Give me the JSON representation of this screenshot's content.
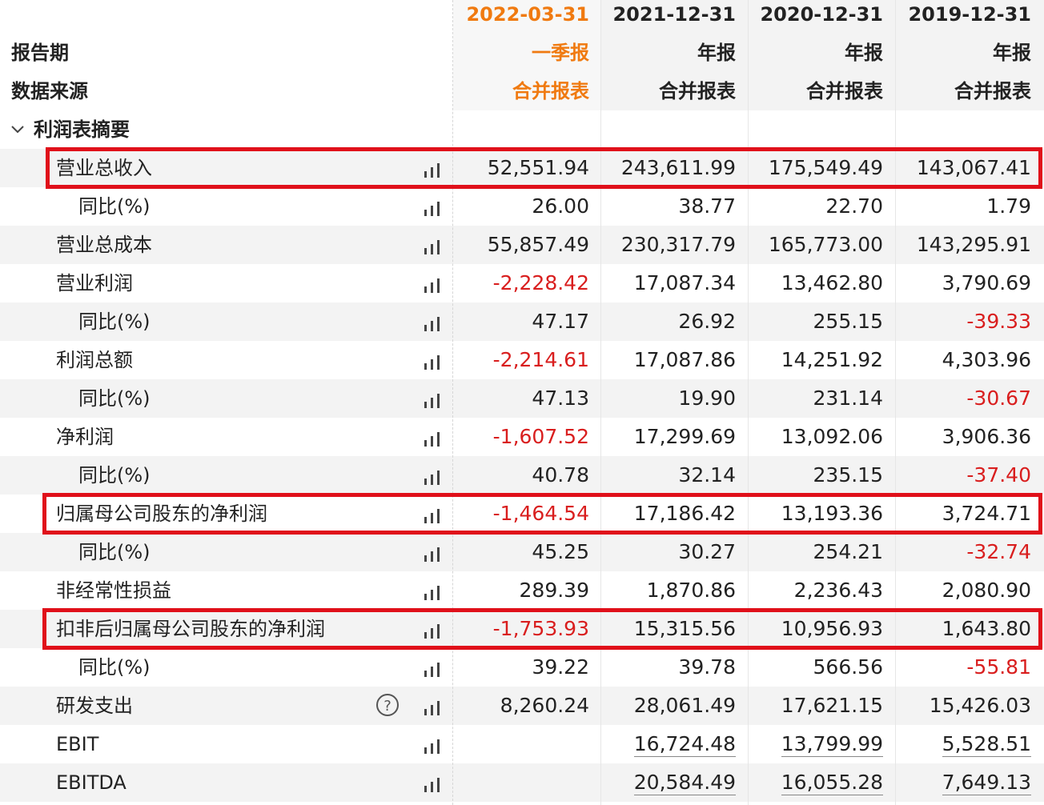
{
  "header": {
    "periods": [
      "2022-03-31",
      "2021-12-31",
      "2020-12-31",
      "2019-12-31"
    ],
    "report_period_label": "报告期",
    "report_types": [
      "一季报",
      "年报",
      "年报",
      "年报"
    ],
    "source_label": "数据来源",
    "sources": [
      "合并报表",
      "合并报表",
      "合并报表",
      "合并报表"
    ]
  },
  "section": {
    "title": "利润表摘要",
    "expand_icon": "chevron-down-icon"
  },
  "rows": [
    {
      "name": "营业总收入",
      "level": 1,
      "values": [
        "52,551.94",
        "243,611.99",
        "175,549.49",
        "143,067.41"
      ],
      "neg": [
        false,
        false,
        false,
        false
      ],
      "highlight": true
    },
    {
      "name": "同比(%)",
      "level": 2,
      "values": [
        "26.00",
        "38.77",
        "22.70",
        "1.79"
      ],
      "neg": [
        false,
        false,
        false,
        false
      ]
    },
    {
      "name": "营业总成本",
      "level": 1,
      "values": [
        "55,857.49",
        "230,317.79",
        "165,773.00",
        "143,295.91"
      ],
      "neg": [
        false,
        false,
        false,
        false
      ]
    },
    {
      "name": "营业利润",
      "level": 1,
      "values": [
        "-2,228.42",
        "17,087.34",
        "13,462.80",
        "3,790.69"
      ],
      "neg": [
        true,
        false,
        false,
        false
      ]
    },
    {
      "name": "同比(%)",
      "level": 2,
      "values": [
        "47.17",
        "26.92",
        "255.15",
        "-39.33"
      ],
      "neg": [
        false,
        false,
        false,
        true
      ]
    },
    {
      "name": "利润总额",
      "level": 1,
      "values": [
        "-2,214.61",
        "17,087.86",
        "14,251.92",
        "4,303.96"
      ],
      "neg": [
        true,
        false,
        false,
        false
      ]
    },
    {
      "name": "同比(%)",
      "level": 2,
      "values": [
        "47.13",
        "19.90",
        "231.14",
        "-30.67"
      ],
      "neg": [
        false,
        false,
        false,
        true
      ]
    },
    {
      "name": "净利润",
      "level": 1,
      "values": [
        "-1,607.52",
        "17,299.69",
        "13,092.06",
        "3,906.36"
      ],
      "neg": [
        true,
        false,
        false,
        false
      ]
    },
    {
      "name": "同比(%)",
      "level": 2,
      "values": [
        "40.78",
        "32.14",
        "235.15",
        "-37.40"
      ],
      "neg": [
        false,
        false,
        false,
        true
      ]
    },
    {
      "name": "归属母公司股东的净利润",
      "level": 1,
      "values": [
        "-1,464.54",
        "17,186.42",
        "13,193.36",
        "3,724.71"
      ],
      "neg": [
        true,
        false,
        false,
        false
      ],
      "highlight": true
    },
    {
      "name": "同比(%)",
      "level": 2,
      "values": [
        "45.25",
        "30.27",
        "254.21",
        "-32.74"
      ],
      "neg": [
        false,
        false,
        false,
        true
      ]
    },
    {
      "name": "非经常性损益",
      "level": 1,
      "values": [
        "289.39",
        "1,870.86",
        "2,236.43",
        "2,080.90"
      ],
      "neg": [
        false,
        false,
        false,
        false
      ]
    },
    {
      "name": "扣非后归属母公司股东的净利润",
      "level": 1,
      "values": [
        "-1,753.93",
        "15,315.56",
        "10,956.93",
        "1,643.80"
      ],
      "neg": [
        true,
        false,
        false,
        false
      ],
      "highlight": true
    },
    {
      "name": "同比(%)",
      "level": 2,
      "values": [
        "39.22",
        "39.78",
        "566.56",
        "-55.81"
      ],
      "neg": [
        false,
        false,
        false,
        true
      ]
    },
    {
      "name": "研发支出",
      "level": 1,
      "values": [
        "8,260.24",
        "28,061.49",
        "17,621.15",
        "15,426.03"
      ],
      "neg": [
        false,
        false,
        false,
        false
      ],
      "help_icon": "question-circle-icon",
      "help_text": "?"
    },
    {
      "name": "EBIT",
      "level": 1,
      "values": [
        "",
        "16,724.48",
        "13,799.99",
        "5,528.51"
      ],
      "neg": [
        false,
        false,
        false,
        false
      ],
      "underline": true
    },
    {
      "name": "EBITDA",
      "level": 1,
      "values": [
        "",
        "20,584.49",
        "16,055.28",
        "7,649.13"
      ],
      "neg": [
        false,
        false,
        false,
        false
      ],
      "underline": true
    }
  ],
  "icons": {
    "chart": "bar-chart-icon"
  },
  "colors": {
    "accent": "#f07a10",
    "negative": "#d91e1e",
    "highlight_border": "#e0101a"
  }
}
